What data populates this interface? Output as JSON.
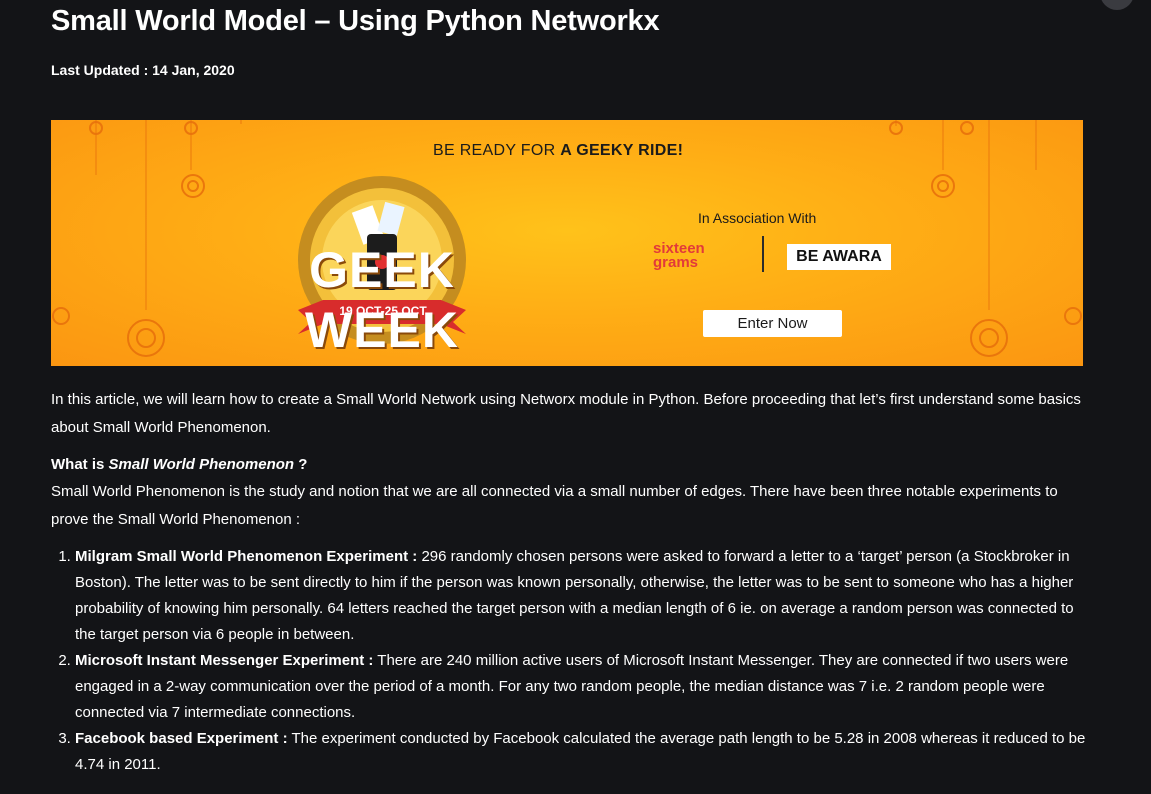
{
  "article": {
    "title": "Small World Model – Using Python Networkx",
    "last_updated": "Last Updated : 14 Jan, 2020",
    "intro": "In this article, we will learn how to create a Small World Network using Networx module in Python. Before proceeding that let’s first understand some basics about Small World Phenomenon.",
    "question_prefix": "What is ",
    "question_em": "Small World Phenomenon",
    "question_suffix": " ?",
    "definition": "Small World Phenomenon is the study and notion that we are all connected via a small number of edges. There have been three notable experiments to prove the Small World Phenomenon :",
    "experiments": [
      {
        "name": "Milgram Small World Phenomenon Experiment :",
        "text": " 296 randomly chosen persons were asked to forward a letter to a ‘target’ person (a Stockbroker in Boston). The letter was to be sent directly to him if the person was known personally, otherwise, the letter was to be sent to someone who has a higher probability of knowing him personally. 64 letters reached the target person with a median length of 6 ie. on average a random person was connected to the target person via 6 people in between."
      },
      {
        "name": "Microsoft Instant Messenger Experiment :",
        "text": " There are 240 million active users of Microsoft Instant Messenger. They are connected if two users were engaged in a 2-way communication over the period of a month. For any two random people, the median distance was 7 i.e. 2 random people were connected via 7 intermediate connections."
      },
      {
        "name": "Facebook based Experiment :",
        "text": " The experiment conducted by Facebook calculated the average path length to be 5.28 in 2008 whereas it reduced to be 4.74 in 2011."
      }
    ]
  },
  "banner": {
    "tagline_prefix": "BE READY FOR ",
    "tagline_bold": "A GEEKY RIDE!",
    "geek_week": "GEEK WEEK",
    "dates": "19 OCT-25 OCT",
    "association": "In Association With",
    "partner_1": "sixteen grams",
    "partner_2": "BE AWARA",
    "cta": "Enter Now",
    "colors": {
      "background": "#ffad15",
      "badge_ring": "#d9a32a",
      "ribbon": "#d82c2c"
    }
  },
  "theme": {
    "page_background": "#131417",
    "text": "#ffffff"
  }
}
